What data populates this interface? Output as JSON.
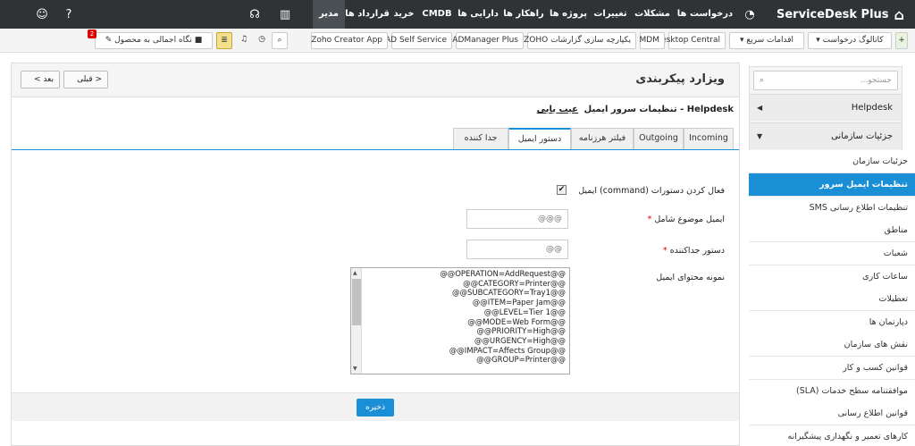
{
  "topnav": {
    "brand": "ServiceDesk Plus",
    "items": [
      "درخواست ها",
      "مشکلات",
      "تغییرات",
      "پروژه ها",
      "راهکار ها",
      "دارایی ها",
      "CMDB",
      "خرید",
      "قرارداد ها",
      "مدیر"
    ],
    "active": "مدیر"
  },
  "toolbar": {
    "catalog": "کاتالوگ درخواست",
    "quick_actions": "اقدامات سریع",
    "buttons": [
      "Desktop Central",
      "MDM",
      "یکپارچه سازی گزارشات ZOHO",
      "ADManager Plus",
      "AD Self Service",
      "Zoho Creator App"
    ],
    "product_overview": "نگاه اجمالی به محصول",
    "notification_count": "2"
  },
  "sidebar": {
    "search_placeholder": "جستجو...",
    "sections": [
      "Helpdesk",
      "جزئیات سازمانی"
    ],
    "items": [
      "جزئیات سازمان",
      "تنظیمات ایمیل سرور",
      "تنظیمات اطلاع رسانی SMS",
      "مناطق",
      "شعبات",
      "ساعات کاری",
      "تعطیلات",
      "دپارتمان ها",
      "نقش های سازمان",
      "قوانین کسب و کار",
      "موافقتنامه سطح خدمات (SLA)",
      "قوانین اطلاع رسانی",
      "کارهای تعمیر و نگهداری پیشگیرانه"
    ],
    "active_item": "تنظیمات ایمیل سرور"
  },
  "main": {
    "title": "ویزارد پیکربندی",
    "prev": "قبلی",
    "next": "بعد",
    "subtitle": "Helpdesk - تنظیمات سرور ایمیل",
    "troubleshoot": "عیب یابی",
    "tabs": [
      "Incoming",
      "Outgoing",
      "فیلتر هرزنامه",
      "دستور ایمیل",
      "جدا کننده"
    ],
    "active_tab": "دستور ایمیل"
  },
  "form": {
    "enable_label": "فعال کردن دستورات (command) ایمیل",
    "enable_checked": true,
    "subject_label": "ایمیل موضوع شامل",
    "subject_value": "@@@",
    "delimiter_label": "دستور جداکننده",
    "delimiter_value": "@@",
    "sample_label": "نمونه محتوای ایمیل",
    "sample_lines": [
      "@@OPERATION=AddRequest@@",
      "@@CATEGORY=Printer@@",
      "@@SUBCATEGORY=Tray1@@",
      "@@ITEM=Paper Jam@@",
      "@@LEVEL=Tier 1@@",
      "@@MODE=Web Form@@",
      "@@PRIORITY=High@@",
      "@@URGENCY=High@@",
      "@@IMPACT=Affects Group@@",
      "@@GROUP=Printer@@"
    ],
    "save": "ذخیره"
  }
}
